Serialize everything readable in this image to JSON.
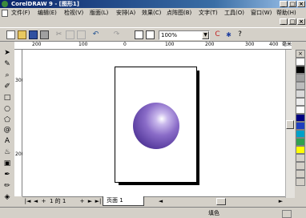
{
  "window": {
    "title": "CorelDRAW 9 - [图形1]"
  },
  "menu": [
    "文件(F)",
    "编辑(E)",
    "检视(V)",
    "版面(L)",
    "安排(A)",
    "效果(C)",
    "点阵图(B)",
    "文字(T)",
    "工具(O)",
    "窗口(W)",
    "帮助(H)"
  ],
  "toolbar": {
    "zoom_value": "100%",
    "zoom_arrow": "▼"
  },
  "ruler": {
    "h_labels": [
      "200",
      "100",
      "0",
      "100",
      "200",
      "300",
      "400"
    ],
    "unit": "毫米",
    "v_labels": [
      "300",
      "200"
    ]
  },
  "pages": {
    "counter": "1 的 1",
    "tab_label": "页面 1"
  },
  "status": {
    "fill_label": "填色"
  },
  "palette": {
    "colors": [
      "#ffffff",
      "#000000",
      "#9f9f9f",
      "#bdbdbd",
      "#d9d9d9",
      "#ededed",
      "#ffffff",
      "#000080",
      "#1f3fbf",
      "#00a0c8",
      "#30a050",
      "#ffff00"
    ]
  },
  "scroll": {
    "up_arrow": "▲",
    "down_arrow": "▼",
    "left_arrow": "◄",
    "right_arrow": "►"
  },
  "caption_buttons": {
    "minimize": "_",
    "maximize": "□",
    "close": "×"
  }
}
